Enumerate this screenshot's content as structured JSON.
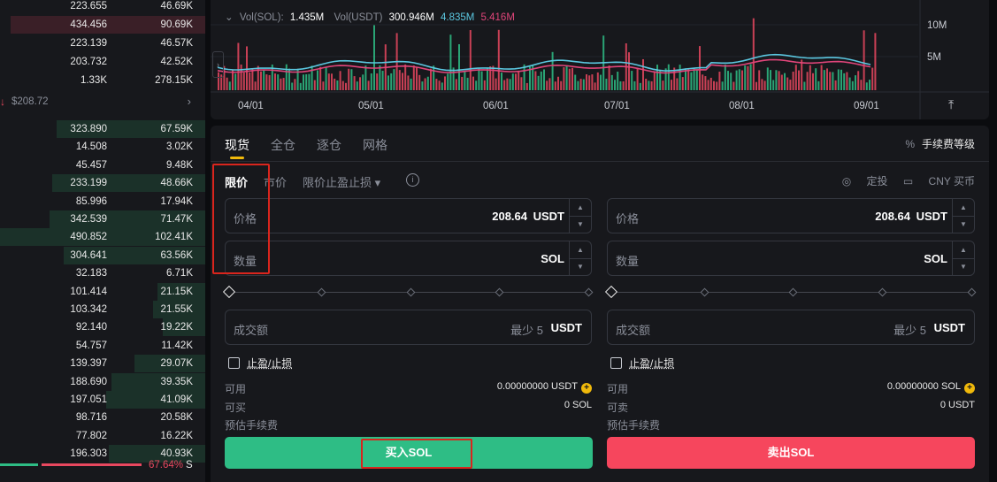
{
  "orderbook": {
    "asks": [
      {
        "price": "223.655",
        "amount": "46.69K"
      },
      {
        "price": "434.456",
        "amount": "90.69K"
      },
      {
        "price": "223.139",
        "amount": "46.57K"
      },
      {
        "price": "203.732",
        "amount": "42.52K"
      },
      {
        "price": "1.33K",
        "amount": "278.15K"
      }
    ],
    "mid_price": "$208.72",
    "bids": [
      {
        "price": "323.890",
        "amount": "67.59K"
      },
      {
        "price": "14.508",
        "amount": "3.02K"
      },
      {
        "price": "45.457",
        "amount": "9.48K"
      },
      {
        "price": "233.199",
        "amount": "48.66K"
      },
      {
        "price": "85.996",
        "amount": "17.94K"
      },
      {
        "price": "342.539",
        "amount": "71.47K"
      },
      {
        "price": "490.852",
        "amount": "102.41K"
      },
      {
        "price": "304.641",
        "amount": "63.56K"
      },
      {
        "price": "32.183",
        "amount": "6.71K"
      },
      {
        "price": "101.414",
        "amount": "21.15K"
      },
      {
        "price": "103.342",
        "amount": "21.55K"
      },
      {
        "price": "92.140",
        "amount": "19.22K"
      },
      {
        "price": "54.757",
        "amount": "11.42K"
      },
      {
        "price": "139.397",
        "amount": "29.07K"
      },
      {
        "price": "188.690",
        "amount": "39.35K"
      },
      {
        "price": "197.051",
        "amount": "41.09K"
      },
      {
        "price": "98.716",
        "amount": "20.58K"
      },
      {
        "price": "77.802",
        "amount": "16.22K"
      },
      {
        "price": "196.303",
        "amount": "40.93K"
      }
    ],
    "sell_ratio": "67.64%",
    "sell_label": "S"
  },
  "chart": {
    "vol_sol_label": "Vol(SOL):",
    "vol_sol_value": "1.435M",
    "vol_usdt_label": "Vol(USDT)",
    "vol_usdt_value": "300.946M",
    "ma1_value": "4.835M",
    "ma2_value": "5.416M",
    "y_ticks": [
      "10M",
      "5M"
    ],
    "x_ticks": [
      "04/01",
      "05/01",
      "06/01",
      "07/01",
      "08/01",
      "09/01"
    ],
    "colors": {
      "up": "#2ebd85",
      "down": "#e8485f",
      "ma1": "#5bc7e0",
      "ma2": "#e0457a"
    }
  },
  "trade": {
    "tabs": [
      "现货",
      "全仓",
      "逐仓",
      "网格"
    ],
    "fee_label": "手续费等级",
    "fee_icon": "%",
    "order_types": [
      "限价",
      "市价",
      "限价止盈止损 ▾"
    ],
    "info_icon": "i",
    "right_links": [
      "定投",
      "CNY 买币"
    ],
    "buy": {
      "price_label": "价格",
      "price_value": "208.64",
      "price_unit": "USDT",
      "qty_label": "数量",
      "qty_unit": "SOL",
      "total_label": "成交额",
      "total_min": "最少 5",
      "total_unit": "USDT",
      "tpsl_label": "止盈/止损",
      "avail_label": "可用",
      "avail_value": "0.00000000 USDT",
      "can_label": "可买",
      "can_value": "0 SOL",
      "fee_label": "预估手续费",
      "button": "买入SOL"
    },
    "sell": {
      "price_label": "价格",
      "price_value": "208.64",
      "price_unit": "USDT",
      "qty_label": "数量",
      "qty_unit": "SOL",
      "total_label": "成交额",
      "total_min": "最少 5",
      "total_unit": "USDT",
      "tpsl_label": "止盈/止损",
      "avail_label": "可用",
      "avail_value": "0.00000000 SOL",
      "can_label": "可卖",
      "can_value": "0 USDT",
      "fee_label": "预估手续费",
      "button": "卖出SOL"
    }
  }
}
